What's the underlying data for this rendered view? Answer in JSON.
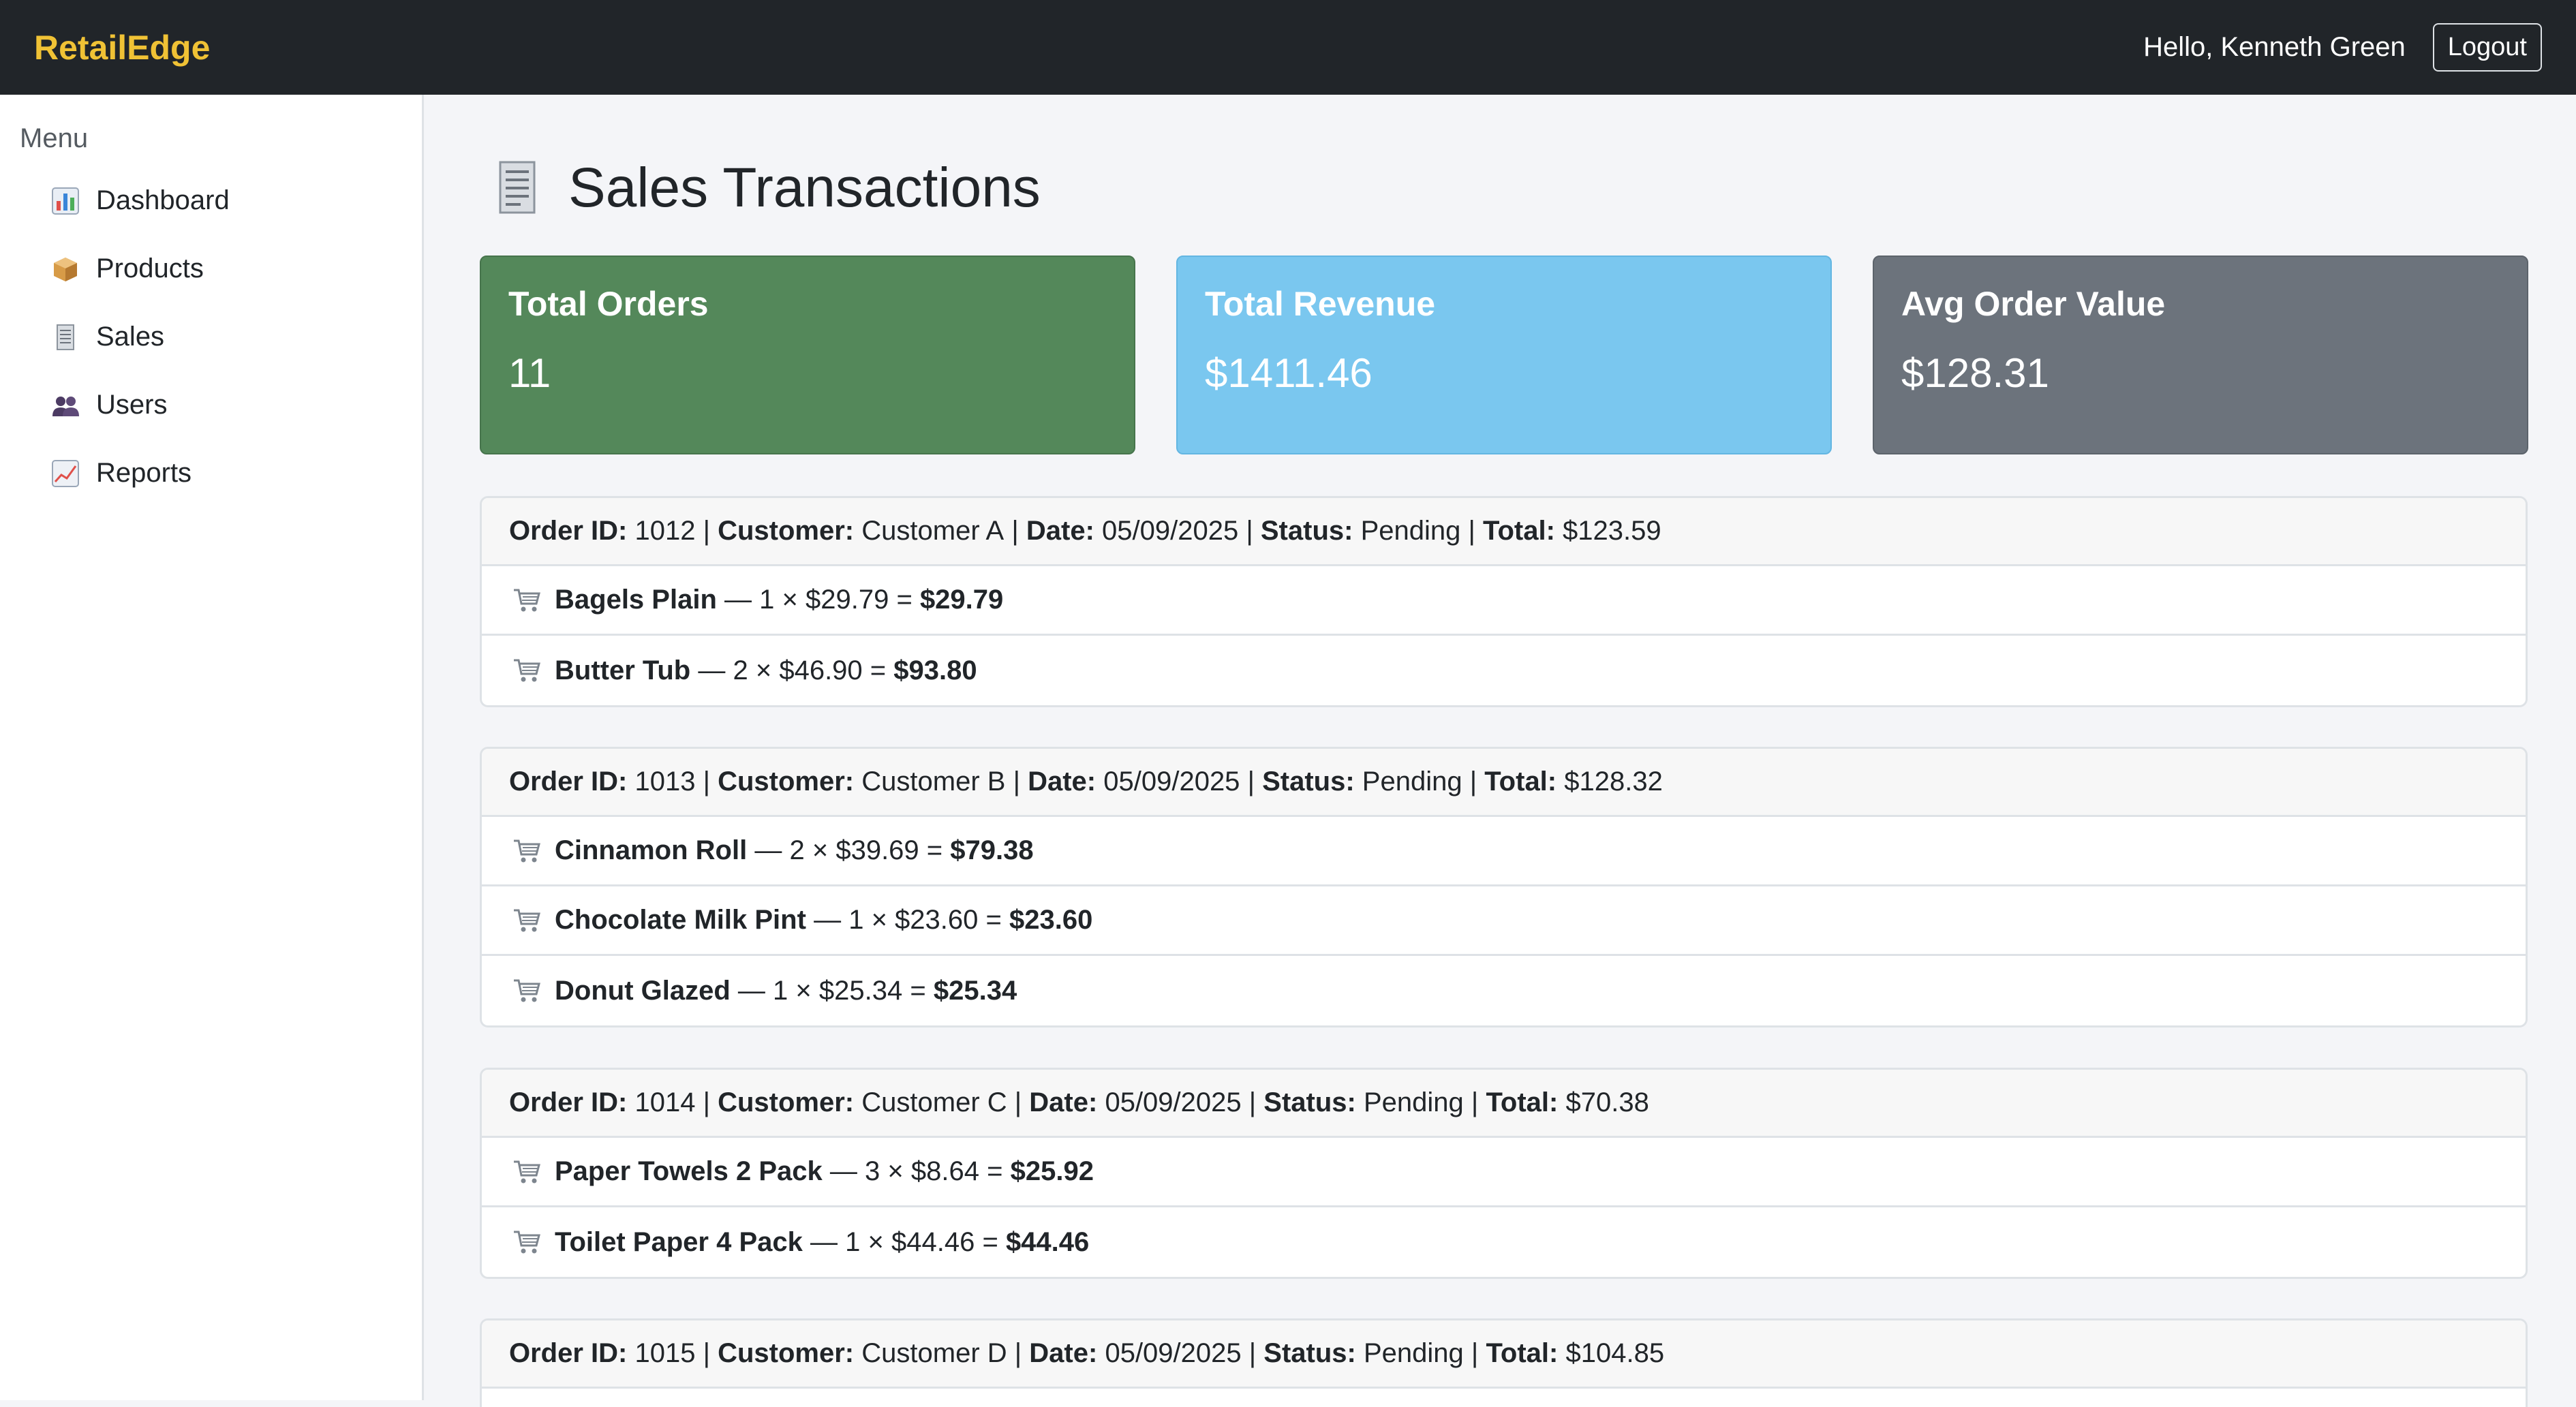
{
  "navbar": {
    "brand": "RetailEdge",
    "greeting": "Hello, Kenneth Green",
    "logout_label": "Logout"
  },
  "sidebar": {
    "title": "Menu",
    "items": [
      {
        "label": "Dashboard",
        "icon": "bar-chart-icon"
      },
      {
        "label": "Products",
        "icon": "package-icon"
      },
      {
        "label": "Sales",
        "icon": "receipt-icon"
      },
      {
        "label": "Users",
        "icon": "users-icon"
      },
      {
        "label": "Reports",
        "icon": "line-chart-icon"
      }
    ]
  },
  "page": {
    "title": "Sales Transactions",
    "title_icon": "receipt-icon"
  },
  "stats": [
    {
      "label": "Total Orders",
      "value": "11",
      "color": "#54885a"
    },
    {
      "label": "Total Revenue",
      "value": "$1411.46",
      "color": "#7ac7ef"
    },
    {
      "label": "Avg Order Value",
      "value": "$128.31",
      "color": "#6c737c"
    }
  ],
  "labels": {
    "order_id": "Order ID:",
    "customer": "Customer:",
    "date": "Date:",
    "status": "Status:",
    "total": "Total:",
    "sep": "|",
    "dash": "—",
    "times": "×",
    "equals": "="
  },
  "orders": [
    {
      "id": "1012",
      "customer": "Customer A",
      "date": "05/09/2025",
      "status": "Pending",
      "total": "$123.59",
      "items": [
        {
          "name": "Bagels Plain",
          "qty": "1",
          "price": "$29.79",
          "subtotal": "$29.79"
        },
        {
          "name": "Butter Tub",
          "qty": "2",
          "price": "$46.90",
          "subtotal": "$93.80"
        }
      ]
    },
    {
      "id": "1013",
      "customer": "Customer B",
      "date": "05/09/2025",
      "status": "Pending",
      "total": "$128.32",
      "items": [
        {
          "name": "Cinnamon Roll",
          "qty": "2",
          "price": "$39.69",
          "subtotal": "$79.38"
        },
        {
          "name": "Chocolate Milk Pint",
          "qty": "1",
          "price": "$23.60",
          "subtotal": "$23.60"
        },
        {
          "name": "Donut Glazed",
          "qty": "1",
          "price": "$25.34",
          "subtotal": "$25.34"
        }
      ]
    },
    {
      "id": "1014",
      "customer": "Customer C",
      "date": "05/09/2025",
      "status": "Pending",
      "total": "$70.38",
      "items": [
        {
          "name": "Paper Towels 2 Pack",
          "qty": "3",
          "price": "$8.64",
          "subtotal": "$25.92"
        },
        {
          "name": "Toilet Paper 4 Pack",
          "qty": "1",
          "price": "$44.46",
          "subtotal": "$44.46"
        }
      ]
    },
    {
      "id": "1015",
      "customer": "Customer D",
      "date": "05/09/2025",
      "status": "Pending",
      "total": "$104.85",
      "items": []
    }
  ]
}
